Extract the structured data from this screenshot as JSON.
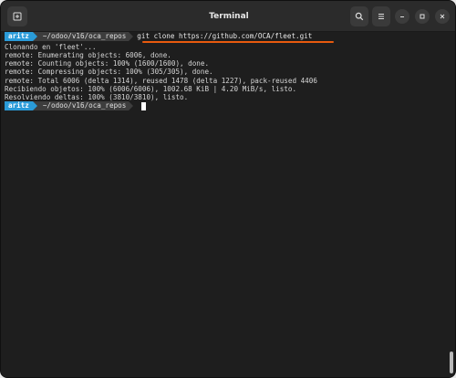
{
  "window": {
    "title": "Terminal"
  },
  "titlebar": {
    "new_tab_icon": "new-tab-icon",
    "search_icon": "search-icon",
    "menu_icon": "hamburger-menu-icon",
    "minimize_icon": "minimize-icon",
    "maximize_icon": "maximize-icon",
    "close_icon": "close-icon"
  },
  "colors": {
    "user_segment": "#2a9bd8",
    "path_segment": "#3d3d3d",
    "annotation_underline": "#e85a0e",
    "background": "#1e1e1e"
  },
  "terminal": {
    "prompt1": {
      "user": "aritz",
      "path": "~/odoo/v16/oca_repos",
      "command": "git clone https://github.com/OCA/fleet.git"
    },
    "output": [
      "Clonando en 'fleet'...",
      "remote: Enumerating objects: 6006, done.",
      "remote: Counting objects: 100% (1600/1600), done.",
      "remote: Compressing objects: 100% (305/305), done.",
      "remote: Total 6006 (delta 1314), reused 1478 (delta 1227), pack-reused 4406",
      "Recibiendo objetos: 100% (6006/6006), 1002.68 KiB | 4.20 MiB/s, listo.",
      "Resolviendo deltas: 100% (3810/3810), listo."
    ],
    "prompt2": {
      "user": "aritz",
      "path": "~/odoo/v16/oca_repos",
      "command": ""
    }
  }
}
